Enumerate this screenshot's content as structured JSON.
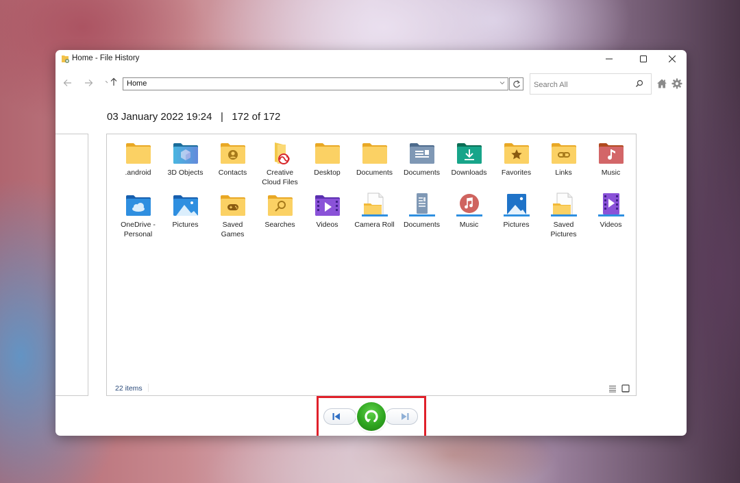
{
  "window": {
    "title": "Home - File History",
    "controls": {
      "minimize": "minimize",
      "maximize": "maximize",
      "close": "close"
    }
  },
  "toolbar": {
    "address": "Home",
    "search_placeholder": "Search All",
    "icons": [
      "back-arrow-icon",
      "forward-arrow-icon",
      "up-arrow-icon",
      "refresh-icon",
      "search-icon",
      "home-icon",
      "gear-icon"
    ]
  },
  "header": {
    "date": "03 January 2022 19:24",
    "separator": "|",
    "position": "172 of 172"
  },
  "items": [
    {
      "label": ".android",
      "icon": "folder-icon"
    },
    {
      "label": "3D Objects",
      "icon": "3d-objects-folder-icon"
    },
    {
      "label": "Contacts",
      "icon": "contacts-folder-icon"
    },
    {
      "label": "Creative Cloud Files",
      "icon": "creative-cloud-folder-icon"
    },
    {
      "label": "Desktop",
      "icon": "folder-icon"
    },
    {
      "label": "Documents",
      "icon": "folder-icon"
    },
    {
      "label": "Documents",
      "icon": "documents-folder-icon"
    },
    {
      "label": "Downloads",
      "icon": "downloads-folder-icon"
    },
    {
      "label": "Favorites",
      "icon": "favorites-folder-icon"
    },
    {
      "label": "Links",
      "icon": "links-folder-icon"
    },
    {
      "label": "Music",
      "icon": "music-folder-icon"
    },
    {
      "label": "OneDrive - Personal",
      "icon": "onedrive-folder-icon"
    },
    {
      "label": "Pictures",
      "icon": "pictures-folder-icon"
    },
    {
      "label": "Saved Games",
      "icon": "saved-games-folder-icon"
    },
    {
      "label": "Searches",
      "icon": "searches-folder-icon"
    },
    {
      "label": "Videos",
      "icon": "videos-folder-icon"
    },
    {
      "label": "Camera Roll",
      "icon": "camera-roll-library-icon"
    },
    {
      "label": "Documents",
      "icon": "documents-library-icon"
    },
    {
      "label": "Music",
      "icon": "music-library-icon"
    },
    {
      "label": "Pictures",
      "icon": "pictures-library-icon"
    },
    {
      "label": "Saved Pictures",
      "icon": "saved-pictures-library-icon"
    },
    {
      "label": "Videos",
      "icon": "videos-library-icon"
    }
  ],
  "status": {
    "item_count": "22 items"
  },
  "playback": {
    "previous": "previous-version",
    "restore": "restore",
    "next": "next-version"
  },
  "colors": {
    "restore_green": "#2fa520",
    "highlight_red": "#e0202a",
    "folder_yellow": "#f7c948",
    "nav_blue": "#3a78c8"
  }
}
